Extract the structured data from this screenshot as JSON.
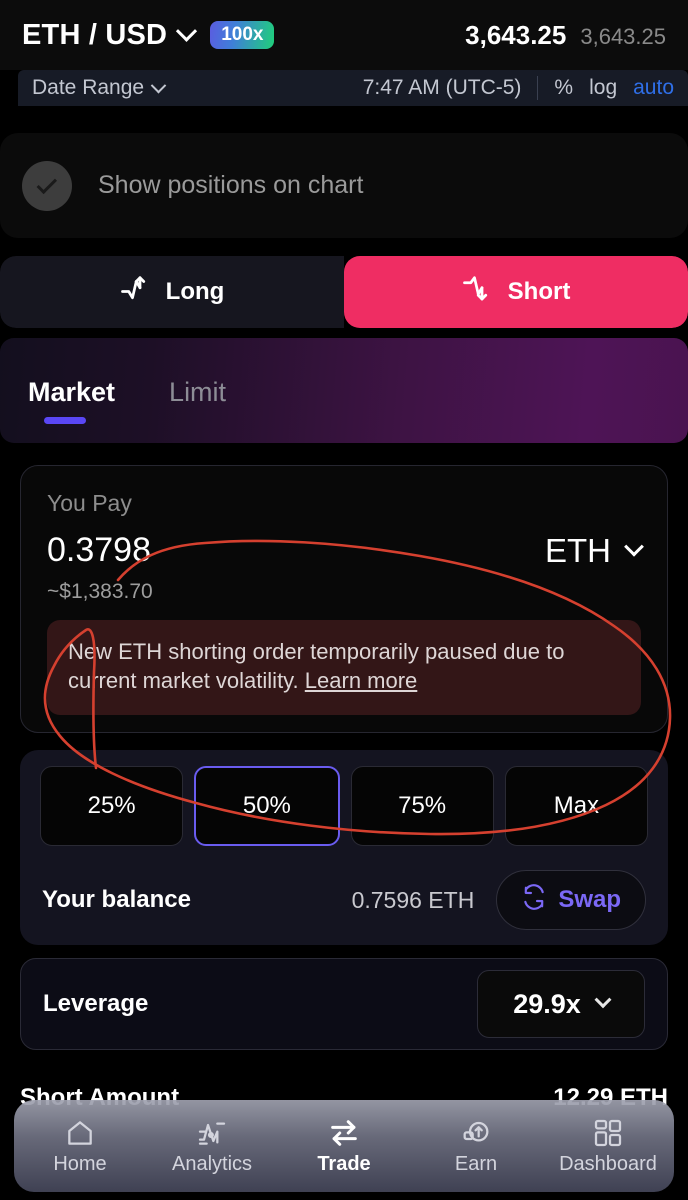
{
  "topbar": {
    "pair": "ETH / USD",
    "pair_chevron_icon": "chevron-down-icon",
    "leverage_badge": "100x",
    "price_main": "3,643.25",
    "price_secondary": "3,643.25"
  },
  "chart_toolbar": {
    "date_range_label": "Date Range",
    "date_range_chevron_icon": "chevron-down-icon",
    "time": "7:47 AM (UTC-5)",
    "percent_label": "%",
    "log_label": "log",
    "auto_label": "auto",
    "auto_color": "#2f6fe8"
  },
  "show_positions": {
    "label": "Show positions on chart",
    "checkbox_icon": "check-icon",
    "checked": true
  },
  "direction_toggle": {
    "long_label": "Long",
    "long_icon": "trend-up-icon",
    "short_label": "Short",
    "short_icon": "trend-down-icon",
    "active": "Short",
    "short_color": "#ef2d63"
  },
  "order_tabs": {
    "items": [
      {
        "label": "Market",
        "active": true
      },
      {
        "label": "Limit",
        "active": false
      }
    ],
    "underline_color": "#5a47f5"
  },
  "pay_card": {
    "label": "You Pay",
    "amount": "0.3798",
    "token": "ETH",
    "token_chevron_icon": "chevron-down-icon",
    "usd_value": "~$1,383.70",
    "warning": {
      "text": "New ETH shorting order temporarily paused due to current market volatility. ",
      "link_label": "Learn more",
      "background": "#331617"
    }
  },
  "percent_card": {
    "buttons": [
      {
        "label": "25%",
        "selected": false
      },
      {
        "label": "50%",
        "selected": true
      },
      {
        "label": "75%",
        "selected": false
      },
      {
        "label": "Max",
        "selected": false
      }
    ],
    "selected_border_color": "#6a5cf0",
    "balance_label": "Your balance",
    "balance_value": "0.7596 ETH",
    "swap_label": "Swap",
    "swap_icon": "swap-refresh-icon",
    "swap_color": "#7b68f5"
  },
  "leverage_card": {
    "label": "Leverage",
    "value": "29.9x",
    "chevron_icon": "chevron-down-icon"
  },
  "obscured_row": {
    "label": "Short Amount",
    "value": "12.29 ETH"
  },
  "bottom_nav": {
    "items": [
      {
        "label": "Home",
        "icon": "home-icon",
        "active": false
      },
      {
        "label": "Analytics",
        "icon": "analytics-chart-icon",
        "active": false
      },
      {
        "label": "Trade",
        "icon": "swap-arrows-icon",
        "active": true
      },
      {
        "label": "Earn",
        "icon": "coin-up-arrow-icon",
        "active": false
      },
      {
        "label": "Dashboard",
        "icon": "grid-dashboard-icon",
        "active": false
      }
    ]
  },
  "annotation": {
    "type": "hand-drawn-ellipse",
    "color": "#d5402f",
    "targets": "You Pay amount and warning banner"
  }
}
